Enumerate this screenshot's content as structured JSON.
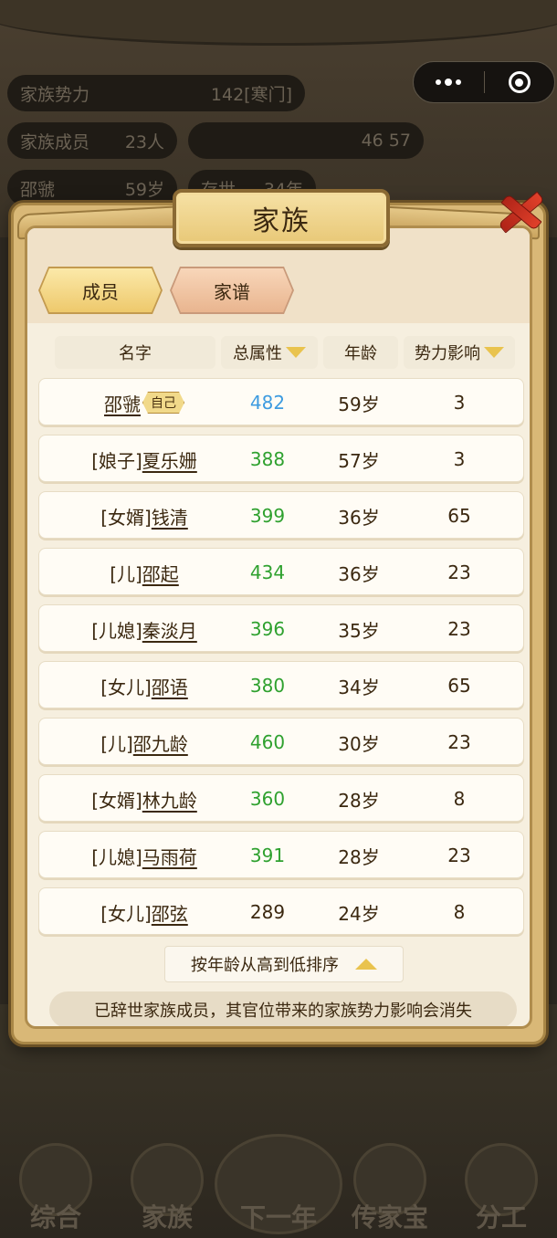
{
  "background": {
    "stats": [
      {
        "label": "家族势力",
        "value": "142[寒门]"
      },
      {
        "label": "家族成员",
        "value": "23人"
      },
      {
        "label": "",
        "value": "46 57"
      },
      {
        "label": "邵虢",
        "value": "59岁"
      },
      {
        "label": "存世",
        "value": "34年"
      }
    ],
    "nav": [
      "综合",
      "家族",
      "下一年",
      "传家宝",
      "分工"
    ]
  },
  "dialog": {
    "title": "家族",
    "tabs": [
      "成员",
      "家谱"
    ],
    "headers": {
      "name": "名字",
      "attr": "总属性",
      "age": "年龄",
      "influence": "势力影响"
    },
    "self_badge": "自己",
    "members": [
      {
        "prefix": "",
        "name": "邵虢",
        "is_self": true,
        "attr": "482",
        "attr_color": "blue",
        "age": "59岁",
        "influence": "3"
      },
      {
        "prefix": "[娘子]",
        "name": "夏乐姗",
        "is_self": false,
        "attr": "388",
        "attr_color": "green",
        "age": "57岁",
        "influence": "3"
      },
      {
        "prefix": "[女婿]",
        "name": "钱清",
        "is_self": false,
        "attr": "399",
        "attr_color": "green",
        "age": "36岁",
        "influence": "65"
      },
      {
        "prefix": "[儿]",
        "name": "邵起",
        "is_self": false,
        "attr": "434",
        "attr_color": "green",
        "age": "36岁",
        "influence": "23"
      },
      {
        "prefix": "[儿媳]",
        "name": "秦淡月",
        "is_self": false,
        "attr": "396",
        "attr_color": "green",
        "age": "35岁",
        "influence": "23"
      },
      {
        "prefix": "[女儿]",
        "name": "邵语",
        "is_self": false,
        "attr": "380",
        "attr_color": "green",
        "age": "34岁",
        "influence": "65"
      },
      {
        "prefix": "[儿]",
        "name": "邵九龄",
        "is_self": false,
        "attr": "460",
        "attr_color": "green",
        "age": "30岁",
        "influence": "23"
      },
      {
        "prefix": "[女婿]",
        "name": "林九龄",
        "is_self": false,
        "attr": "360",
        "attr_color": "green",
        "age": "28岁",
        "influence": "8"
      },
      {
        "prefix": "[儿媳]",
        "name": "马雨荷",
        "is_self": false,
        "attr": "391",
        "attr_color": "green",
        "age": "28岁",
        "influence": "23"
      },
      {
        "prefix": "[女儿]",
        "name": "邵弦",
        "is_self": false,
        "attr": "289",
        "attr_color": "default",
        "age": "24岁",
        "influence": "8"
      }
    ],
    "sort_label": "按年龄从高到低排序",
    "notice": "已辞世家族成员，其官位带来的家族势力影响会消失"
  },
  "icons": {
    "close": "close-x-icon",
    "more": "more-dots-icon",
    "target": "target-icon",
    "sort": "triangle-up-icon",
    "filter": "triangle-down-icon"
  },
  "colors": {
    "blue_value": "#3d9be0",
    "green_value": "#2fa12f",
    "gold_accent": "#e9c34e"
  }
}
